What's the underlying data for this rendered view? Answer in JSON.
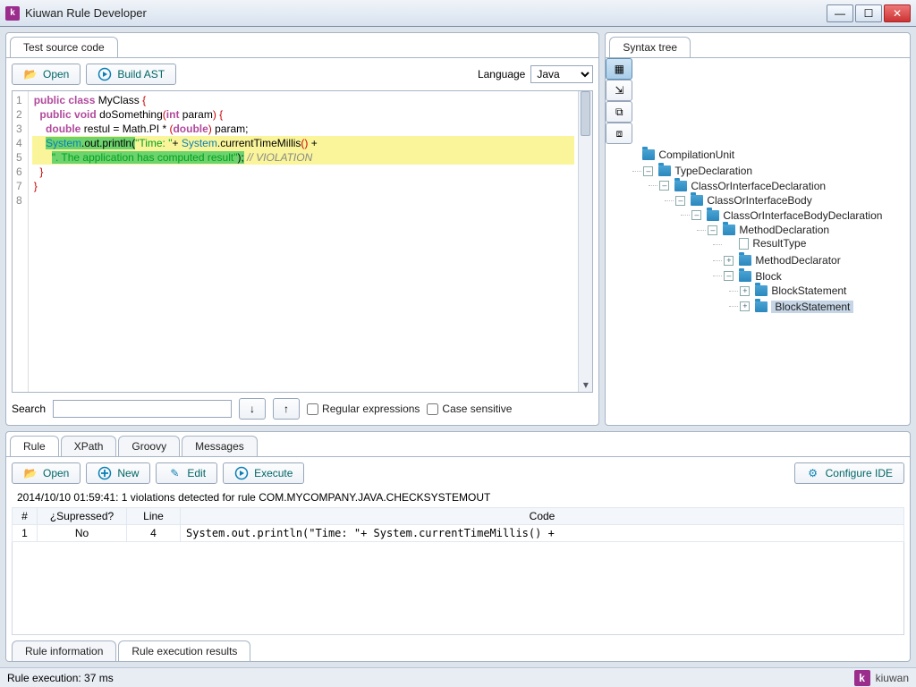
{
  "window": {
    "title": "Kiuwan Rule Developer"
  },
  "source": {
    "tab_label": "Test source code",
    "open_label": "Open",
    "build_label": "Build AST",
    "language_label": "Language",
    "language_value": "Java",
    "search_label": "Search",
    "regex_label": "Regular expressions",
    "case_label": "Case sensitive",
    "lines": [
      {
        "n": "1",
        "html": "<span class='kw'>public</span> <span class='kw'>class</span> <span class='id'>MyClass</span> <span class='red'>{</span>"
      },
      {
        "n": "2",
        "html": "  <span class='kw'>public</span> <span class='kw'>void</span> <span class='id'>doSomething</span><span class='red'>(</span><span class='kw'>int</span> <span class='id'>param</span><span class='red'>)</span> <span class='red'>{</span>"
      },
      {
        "n": "3",
        "html": "    <span class='kw'>double</span> <span class='id'>restul</span> = <span class='id'>Math</span>.<span class='id'>PI</span> * <span class='red'>(</span><span class='kw'>double</span><span class='red'>)</span> <span class='id'>param</span>;"
      },
      {
        "n": "4",
        "hl": "yellow",
        "html": "    <span class='hl-green'><span class='blue'>System</span>.out.println(</span><span class='str'>\"Time: \"</span>+ <span class='blue'>System</span>.currentTimeMillis<span class='red'>()</span> +"
      },
      {
        "n": "5",
        "hl": "yellow",
        "html": "      <span class='hl-green'><span class='str'>\". The application has computed result\"</span>);</span> <span class='cmt'>// VIOLATION</span>"
      },
      {
        "n": "6",
        "html": "  <span class='red'>}</span>"
      },
      {
        "n": "7",
        "html": "<span class='red'>}</span>"
      },
      {
        "n": "8",
        "html": ""
      }
    ]
  },
  "syntax": {
    "tab_label": "Syntax tree",
    "nodes": {
      "compilation_unit": "CompilationUnit",
      "type_declaration": "TypeDeclaration",
      "class_decl": "ClassOrInterfaceDeclaration",
      "class_body": "ClassOrInterfaceBody",
      "class_body_decl": "ClassOrInterfaceBodyDeclaration",
      "method_decl": "MethodDeclaration",
      "result_type": "ResultType",
      "method_declarator": "MethodDeclarator",
      "block": "Block",
      "block_stmt1": "BlockStatement",
      "block_stmt2": "BlockStatement"
    }
  },
  "rule": {
    "tabs": {
      "rule": "Rule",
      "xpath": "XPath",
      "groovy": "Groovy",
      "messages": "Messages"
    },
    "open_label": "Open",
    "new_label": "New",
    "edit_label": "Edit",
    "execute_label": "Execute",
    "configure_label": "Configure IDE",
    "msg": "2014/10/10 01:59:41: 1 violations detected for rule COM.MYCOMPANY.JAVA.CHECKSYSTEMOUT",
    "cols": {
      "num": "#",
      "supressed": "¿Supressed?",
      "line": "Line",
      "code": "Code"
    },
    "rows": [
      {
        "num": "1",
        "supressed": "No",
        "line": "4",
        "code": "System.out.println(\"Time: \"+ System.currentTimeMillis() +"
      }
    ],
    "bottom_tabs": {
      "info": "Rule information",
      "results": "Rule execution results"
    }
  },
  "status": {
    "text": "Rule execution: 37 ms",
    "brand": "kiuwan"
  }
}
